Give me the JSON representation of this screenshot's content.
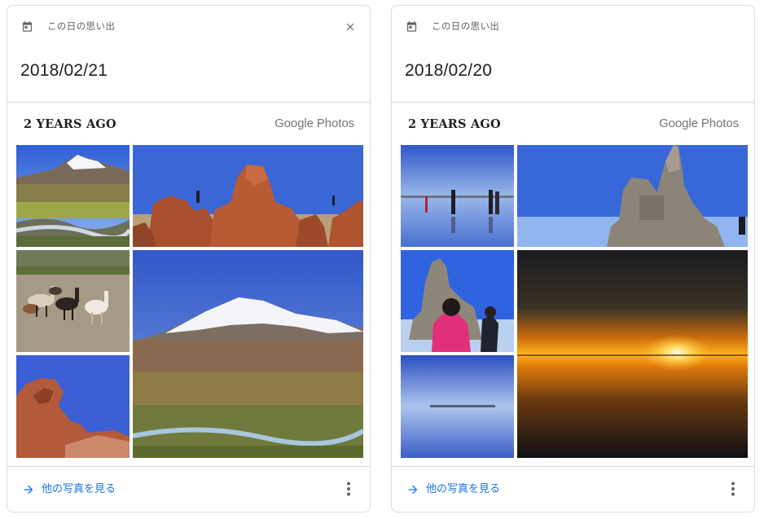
{
  "cards": [
    {
      "header_label": "この日の思い出",
      "date": "2018/02/21",
      "section_title": "2 YEARS AGO",
      "brand": "Google Photos",
      "footer_link": "他の写真を見る",
      "has_close": true,
      "photos": [
        "snowy-volcano-wetland",
        "red-rock-formations",
        "llamas-herd",
        "snowcapped-mountain-grassland",
        "eroded-red-rock"
      ]
    },
    {
      "header_label": "この日の思い出",
      "date": "2018/02/20",
      "section_title": "2 YEARS AGO",
      "brand": "Google Photos",
      "footer_link": "他の写真を見る",
      "has_close": false,
      "photos": [
        "salt-flat-mirror-people",
        "salt-statue-monument",
        "tourist-pink-jacket",
        "salt-flat-horizon",
        "salt-flat-sunset"
      ]
    }
  ],
  "colors": {
    "link": "#1a73e8",
    "muted_text": "#5f6368",
    "divider": "#dadce0"
  },
  "icons": [
    "calendar-icon",
    "close-icon",
    "arrow-right-icon",
    "more-vert-icon"
  ]
}
